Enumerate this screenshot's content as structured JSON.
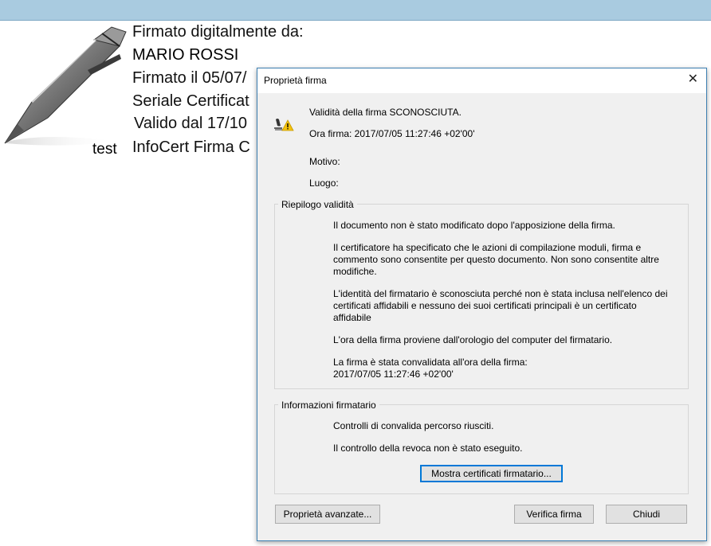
{
  "background_signature": {
    "lines": [
      "Firmato digitalmente da:",
      "MARIO ROSSI",
      "Firmato il 05/07/",
      "Seriale Certificat",
      "Valido dal 17/10",
      "InfoCert Firma C"
    ],
    "label": "test"
  },
  "dialog": {
    "title": "Proprietà firma",
    "close_symbol": "✕",
    "status_icon": "signature-warning-icon",
    "validity": "Validità della firma SCONOSCIUTA.",
    "sign_time": "Ora firma:  2017/07/05 11:27:46 +02'00'",
    "reason_label": "Motivo:",
    "location_label": "Luogo:",
    "summary": {
      "title": "Riepilogo validità",
      "not_modified": "Il documento non è stato modificato dopo l'apposizione della firma.",
      "certifier_1": "Il certificatore ha specificato che le azioni di compilazione moduli, firma e",
      "certifier_2": "commento sono consentite per questo documento. Non sono consentite altre",
      "certifier_3": "modifiche.",
      "identity_1": "L'identità del firmatario è sconosciuta perché non è stata inclusa nell'elenco dei",
      "identity_2": "certificati affidabili e nessuno dei suoi certificati principali è un certificato",
      "identity_3": "affidabile",
      "clock": "L'ora della firma proviene dall'orologio del computer del firmatario.",
      "validated_1": "La firma è stata convalidata all'ora della firma:",
      "validated_2": "2017/07/05 11:27:46 +02'00'"
    },
    "signer_info": {
      "title": "Informazioni firmatario",
      "path_check": "Controlli di convalida percorso riusciti.",
      "revocation": "Il controllo della revoca non è stato eseguito.",
      "show_certs_button": "Mostra certificati firmatario..."
    },
    "buttons": {
      "advanced": "Proprietà avanzate...",
      "verify": "Verifica firma",
      "close": "Chiudi"
    }
  }
}
